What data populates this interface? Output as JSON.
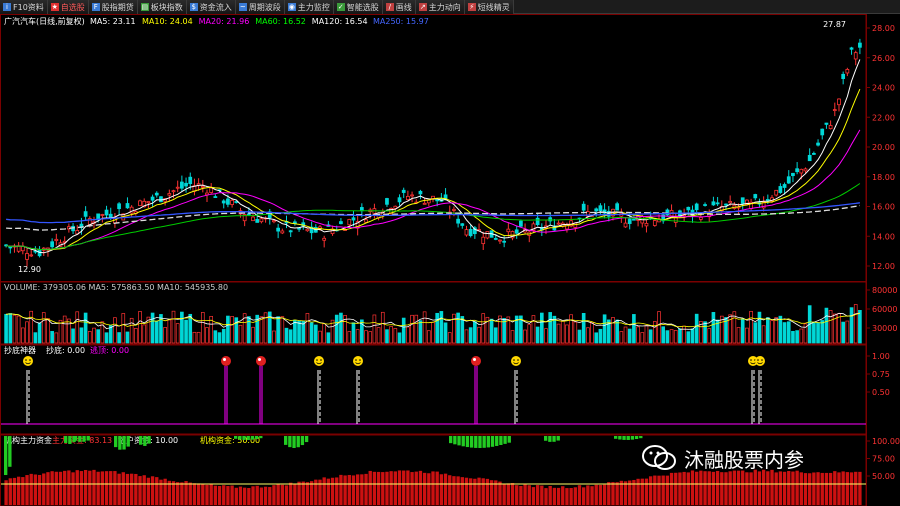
{
  "toolbar": {
    "items": [
      {
        "label": "F10资料",
        "icon": "info-icon",
        "active": false
      },
      {
        "label": "自选股",
        "icon": "star-icon",
        "active": true
      },
      {
        "label": "股指期货",
        "icon": "futures-icon",
        "active": false
      },
      {
        "label": "板块指数",
        "icon": "sector-icon",
        "active": false
      },
      {
        "label": "资金流入",
        "icon": "flow-icon",
        "active": false
      },
      {
        "label": "周期波段",
        "icon": "cycle-icon",
        "active": false
      },
      {
        "label": "主力监控",
        "icon": "monitor-icon",
        "active": false
      },
      {
        "label": "智能选股",
        "icon": "select-icon",
        "active": false
      },
      {
        "label": "画线",
        "icon": "draw-icon",
        "active": false
      },
      {
        "label": "主力动向",
        "icon": "trend-icon",
        "active": false
      },
      {
        "label": "短线精灵",
        "icon": "sprite-icon",
        "active": false
      }
    ]
  },
  "main_panel": {
    "title": "广汽汽车(日线,前复权)",
    "ma_labels": [
      {
        "text": "MA5: 23.11",
        "color": "#ffffff"
      },
      {
        "text": "MA10: 24.04",
        "color": "#ffff00"
      },
      {
        "text": "MA20: 21.96",
        "color": "#ff00ff"
      },
      {
        "text": "MA60: 16.52",
        "color": "#00ff00"
      },
      {
        "text": "MA120: 16.54",
        "color": "#ffffff"
      },
      {
        "text": "MA250: 15.97",
        "color": "#4466ff"
      }
    ],
    "high_label": "27.87",
    "low_label": "12.90",
    "y_ticks": [
      "28.00",
      "26.00",
      "24.00",
      "22.00",
      "20.00",
      "18.00",
      "16.00",
      "14.00",
      "12.00"
    ]
  },
  "volume_panel": {
    "header": "VOLUME: 379305.06  MA5: 575863.50  MA10: 545935.80",
    "y_ticks": [
      "80000",
      "60000",
      "30000"
    ]
  },
  "signal_panel": {
    "header_name": "抄底神器",
    "header_b": "抄底: 0.00",
    "header_c": "逃顶: 0.00",
    "y_ticks": [
      "1.00",
      "0.75",
      "0.50"
    ]
  },
  "flow_panel": {
    "header_name": "机构主力资金",
    "header_a": "主力资金: 83.13",
    "header_b": "散户资金: 10.00",
    "header_c": "机构资金: 50.00",
    "y_ticks": [
      "100.00",
      "75.00",
      "50.00"
    ]
  },
  "watermark": {
    "text": "沐融股票内参"
  },
  "colors": {
    "up": "#ff3333",
    "down": "#00d7d7",
    "background": "#000000",
    "axis": "#7a0000"
  }
}
